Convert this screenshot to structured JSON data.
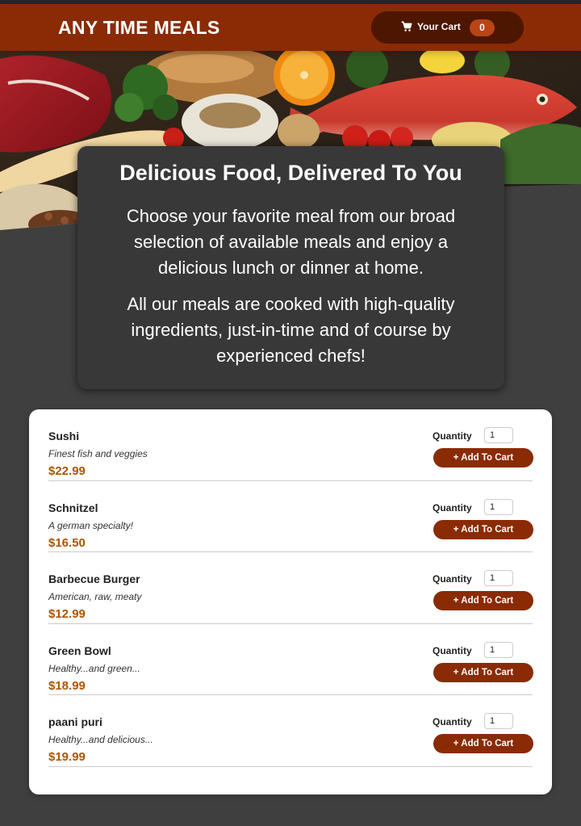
{
  "header": {
    "title": "ANY TIME MEALS",
    "cart_label": "Your Cart",
    "cart_count": "0",
    "cart_icon": "shopping-cart-icon"
  },
  "colors": {
    "header_bg": "#8a2b06",
    "cart_btn_bg": "#4d1601",
    "badge_bg": "#b94517",
    "price": "#ad5502",
    "page_bg": "#3f3f3f",
    "summary_bg": "#383838"
  },
  "summary": {
    "heading": "Delicious Food, Delivered To You",
    "paragraph1": "Choose your favorite meal from our broad selection of available meals and enjoy a delicious lunch or dinner at home.",
    "paragraph2": "All our meals are cooked with high-quality ingredients, just-in-time and of course by experienced chefs!"
  },
  "meals": [
    {
      "name": "Sushi",
      "description": "Finest fish and veggies",
      "price": "$22.99",
      "quantity_label": "Quantity",
      "quantity": "1",
      "button": "+ Add To Cart"
    },
    {
      "name": "Schnitzel",
      "description": "A german specialty!",
      "price": "$16.50",
      "quantity_label": "Quantity",
      "quantity": "1",
      "button": "+ Add To Cart"
    },
    {
      "name": "Barbecue Burger",
      "description": "American, raw, meaty",
      "price": "$12.99",
      "quantity_label": "Quantity",
      "quantity": "1",
      "button": "+ Add To Cart"
    },
    {
      "name": "Green Bowl",
      "description": "Healthy...and green...",
      "price": "$18.99",
      "quantity_label": "Quantity",
      "quantity": "1",
      "button": "+ Add To Cart"
    },
    {
      "name": "paani puri",
      "description": "Healthy...and delicious...",
      "price": "$19.99",
      "quantity_label": "Quantity",
      "quantity": "1",
      "button": "+ Add To Cart"
    }
  ]
}
